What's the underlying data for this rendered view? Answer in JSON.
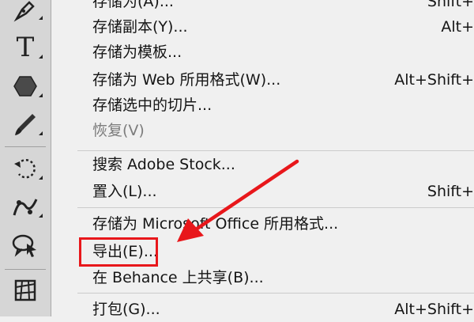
{
  "toolbar": {
    "tools": [
      {
        "icon": "pen-icon"
      },
      {
        "icon": "type-icon",
        "glyph": "T"
      },
      {
        "icon": "polygon-shape-icon"
      },
      {
        "icon": "brush-icon"
      },
      {
        "icon": "rotate-view-icon"
      },
      {
        "icon": "puppet-warp-icon"
      },
      {
        "icon": "select-comment-icon"
      },
      {
        "icon": "perspective-grid-icon"
      }
    ]
  },
  "menu": {
    "items": [
      {
        "label": "存储为(A)...",
        "shortcut": "Shift+"
      },
      {
        "label": "存储副本(Y)...",
        "shortcut": "Alt+"
      },
      {
        "label": "存储为模板...",
        "shortcut": ""
      },
      {
        "label": "存储为 Web 所用格式(W)...",
        "shortcut": "Alt+Shift+"
      },
      {
        "label": "存储选中的切片...",
        "shortcut": ""
      },
      {
        "label": "恢复(V)",
        "shortcut": "",
        "disabled": true
      },
      {
        "label": "搜索 Adobe Stock...",
        "shortcut": ""
      },
      {
        "label": "置入(L)...",
        "shortcut": "Shift+"
      },
      {
        "label": "存储为 Microsoft Office 所用格式...",
        "shortcut": ""
      },
      {
        "label": "导出(E)...",
        "shortcut": ""
      },
      {
        "label": "在 Behance 上共享(B)...",
        "shortcut": ""
      },
      {
        "label": "打包(G)...",
        "shortcut": "Alt+Shift+"
      }
    ]
  },
  "annotation": {
    "color": "#e8171b"
  }
}
